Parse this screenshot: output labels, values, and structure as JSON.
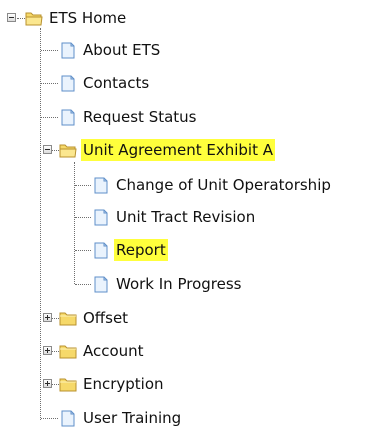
{
  "tree": {
    "root": {
      "label": "ETS Home",
      "icon": "folder-open-icon",
      "expanded": true
    },
    "items": [
      {
        "label": "About ETS",
        "icon": "page-icon"
      },
      {
        "label": "Contacts",
        "icon": "page-icon"
      },
      {
        "label": "Request Status",
        "icon": "page-icon"
      },
      {
        "label": "Unit Agreement Exhibit A",
        "icon": "folder-open-icon",
        "expanded": true,
        "highlighted": true
      },
      {
        "label": "Offset",
        "icon": "folder-icon",
        "expanded": false
      },
      {
        "label": "Account",
        "icon": "folder-icon",
        "expanded": false
      },
      {
        "label": "Encryption",
        "icon": "folder-icon",
        "expanded": false
      },
      {
        "label": "User Training",
        "icon": "page-icon"
      }
    ],
    "children": [
      {
        "label": "Change of Unit Operatorship",
        "icon": "page-icon"
      },
      {
        "label": "Unit Tract Revision",
        "icon": "page-icon"
      },
      {
        "label": "Report",
        "icon": "page-icon",
        "highlighted": true
      },
      {
        "label": "Work In Progress",
        "icon": "page-icon"
      }
    ]
  },
  "colors": {
    "highlight": "#ffff3c",
    "folder": "#f6d96a",
    "page": "#7fa9dc"
  }
}
